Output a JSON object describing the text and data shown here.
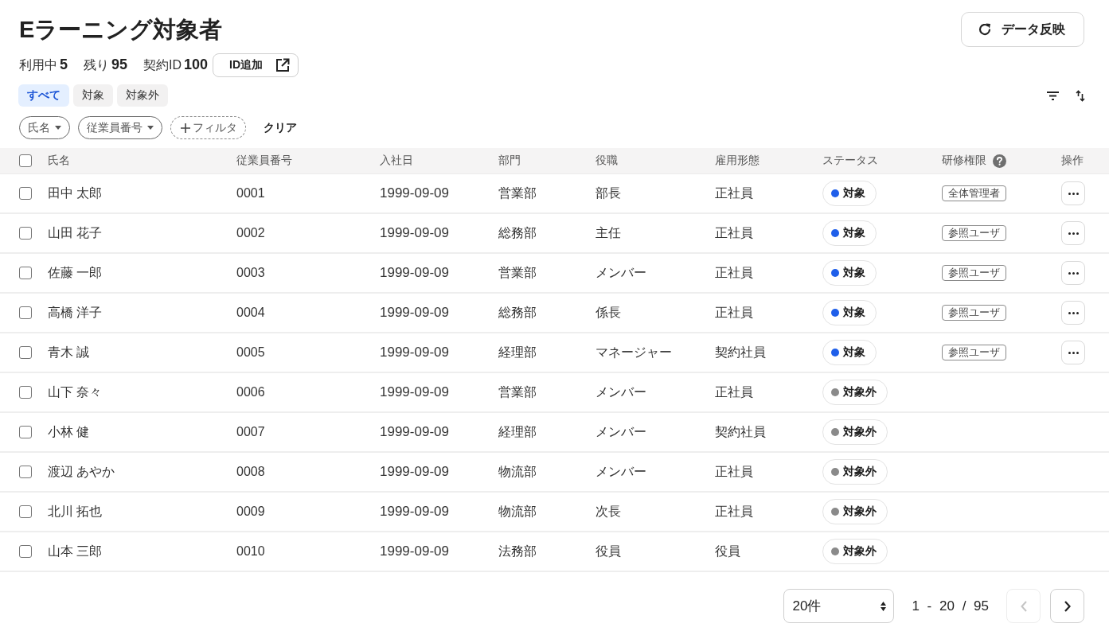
{
  "header": {
    "title": "Eラーニング対象者",
    "refresh_button": "データ反映"
  },
  "stats": [
    {
      "label": "利用中",
      "value": "5"
    },
    {
      "label": "残り",
      "value": "95"
    },
    {
      "label": "契約ID",
      "value": "100"
    }
  ],
  "add_id_button": "ID追加",
  "tabs": [
    {
      "label": "すべて",
      "selected": true
    },
    {
      "label": "対象",
      "selected": false
    },
    {
      "label": "対象外",
      "selected": false
    }
  ],
  "filters": [
    {
      "label": "氏名",
      "kind": "dropdown"
    },
    {
      "label": "従業員番号",
      "kind": "dropdown"
    },
    {
      "label": "フィルタ",
      "kind": "add"
    }
  ],
  "clear_button": "クリア",
  "table": {
    "all_checked": false,
    "columns": [
      {
        "label": "氏名"
      },
      {
        "label": "従業員番号"
      },
      {
        "label": "入社日"
      },
      {
        "label": "部門"
      },
      {
        "label": "役職"
      },
      {
        "label": "雇用形態"
      },
      {
        "label": "ステータス"
      },
      {
        "label": "研修権限",
        "help": true
      },
      {
        "label": "操作"
      }
    ],
    "rows": [
      {
        "checked": false,
        "name": "田中 太郎",
        "employee_no": "0001",
        "hire_date": "1999-09-09",
        "department": "営業部",
        "position": "部長",
        "employment_type": "正社員",
        "status": {
          "label": "対象",
          "color": "#1f5fea"
        },
        "permission": "全体管理者",
        "menu": true
      },
      {
        "checked": false,
        "name": "山田 花子",
        "employee_no": "0002",
        "hire_date": "1999-09-09",
        "department": "総務部",
        "position": "主任",
        "employment_type": "正社員",
        "status": {
          "label": "対象",
          "color": "#1f5fea"
        },
        "permission": "参照ユーザ",
        "menu": true
      },
      {
        "checked": false,
        "name": "佐藤 一郎",
        "employee_no": "0003",
        "hire_date": "1999-09-09",
        "department": "営業部",
        "position": "メンバー",
        "employment_type": "正社員",
        "status": {
          "label": "対象",
          "color": "#1f5fea"
        },
        "permission": "参照ユーザ",
        "menu": true
      },
      {
        "checked": false,
        "name": "高橋 洋子",
        "employee_no": "0004",
        "hire_date": "1999-09-09",
        "department": "総務部",
        "position": "係長",
        "employment_type": "正社員",
        "status": {
          "label": "対象",
          "color": "#1f5fea"
        },
        "permission": "参照ユーザ",
        "menu": true
      },
      {
        "checked": false,
        "name": "青木 誠",
        "employee_no": "0005",
        "hire_date": "1999-09-09",
        "department": "経理部",
        "position": "マネージャー",
        "employment_type": "契約社員",
        "status": {
          "label": "対象",
          "color": "#1f5fea"
        },
        "permission": "参照ユーザ",
        "menu": true
      },
      {
        "checked": false,
        "name": "山下 奈々",
        "employee_no": "0006",
        "hire_date": "1999-09-09",
        "department": "営業部",
        "position": "メンバー",
        "employment_type": "正社員",
        "status": {
          "label": "対象外",
          "color": "#8a8a8a"
        },
        "menu": false
      },
      {
        "checked": false,
        "name": "小林 健",
        "employee_no": "0007",
        "hire_date": "1999-09-09",
        "department": "経理部",
        "position": "メンバー",
        "employment_type": "契約社員",
        "status": {
          "label": "対象外",
          "color": "#8a8a8a"
        },
        "menu": false
      },
      {
        "checked": false,
        "name": "渡辺 あやか",
        "employee_no": "0008",
        "hire_date": "1999-09-09",
        "department": "物流部",
        "position": "メンバー",
        "employment_type": "正社員",
        "status": {
          "label": "対象外",
          "color": "#8a8a8a"
        },
        "menu": false
      },
      {
        "checked": false,
        "name": "北川 拓也",
        "employee_no": "0009",
        "hire_date": "1999-09-09",
        "department": "物流部",
        "position": "次長",
        "employment_type": "正社員",
        "status": {
          "label": "対象外",
          "color": "#8a8a8a"
        },
        "menu": false
      },
      {
        "checked": false,
        "name": "山本 三郎",
        "employee_no": "0010",
        "hire_date": "1999-09-09",
        "department": "法務部",
        "position": "役員",
        "employment_type": "役員",
        "status": {
          "label": "対象外",
          "color": "#8a8a8a"
        },
        "menu": false
      }
    ]
  },
  "pagination": {
    "page_size": "20件",
    "range": "1 - 20 / 95",
    "prev_disabled": true,
    "next_disabled": false
  }
}
